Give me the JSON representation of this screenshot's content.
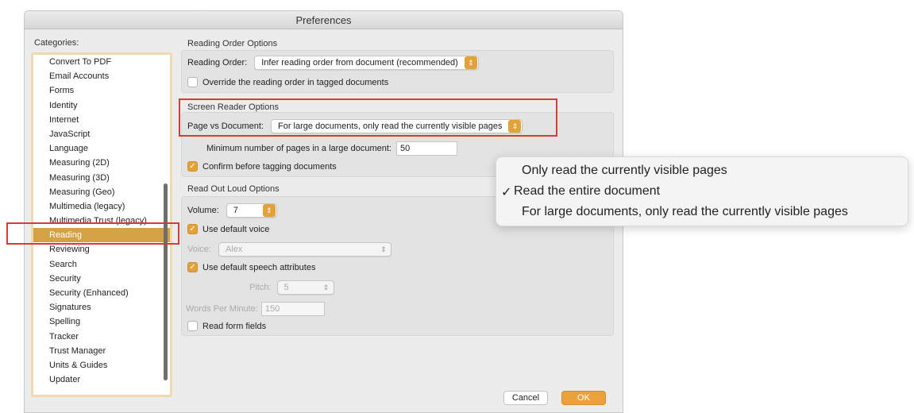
{
  "window": {
    "title": "Preferences"
  },
  "categories": {
    "label": "Categories:",
    "items": [
      "Convert To PDF",
      "Email Accounts",
      "Forms",
      "Identity",
      "Internet",
      "JavaScript",
      "Language",
      "Measuring (2D)",
      "Measuring (3D)",
      "Measuring (Geo)",
      "Multimedia (legacy)",
      "Multimedia Trust (legacy)",
      "Reading",
      "Reviewing",
      "Search",
      "Security",
      "Security (Enhanced)",
      "Signatures",
      "Spelling",
      "Tracker",
      "Trust Manager",
      "Units & Guides",
      "Updater"
    ],
    "selected": "Reading"
  },
  "reading_order": {
    "title": "Reading Order Options",
    "order_label": "Reading Order:",
    "order_value": "Infer reading order from document (recommended)",
    "override_label": "Override the reading order in tagged documents"
  },
  "screen_reader": {
    "title": "Screen Reader Options",
    "page_vs_doc_label": "Page vs Document:",
    "page_vs_doc_value": "For large documents, only read the currently visible pages",
    "min_pages_label": "Minimum number of pages in a large document:",
    "min_pages_value": "50",
    "confirm_label": "Confirm before tagging documents"
  },
  "read_out_loud": {
    "title": "Read Out Loud Options",
    "volume_label": "Volume:",
    "volume_value": "7",
    "default_voice_label": "Use default voice",
    "voice_label": "Voice:",
    "voice_value": "Alex",
    "default_speech_label": "Use default speech attributes",
    "pitch_label": "Pitch:",
    "pitch_value": "5",
    "wpm_label": "Words Per Minute:",
    "wpm_value": "150",
    "form_fields_label": "Read form fields"
  },
  "buttons": {
    "cancel": "Cancel",
    "ok": "OK"
  },
  "dropdown_menu": {
    "items": [
      "Only read the currently visible pages",
      "Read the entire document",
      "For large documents, only read the currently visible pages"
    ],
    "checkmark": "✓",
    "checked_index": 1
  },
  "colors": {
    "accent": "#e3a13a",
    "selected": "#d4a245",
    "highlight": "#d83a35"
  }
}
